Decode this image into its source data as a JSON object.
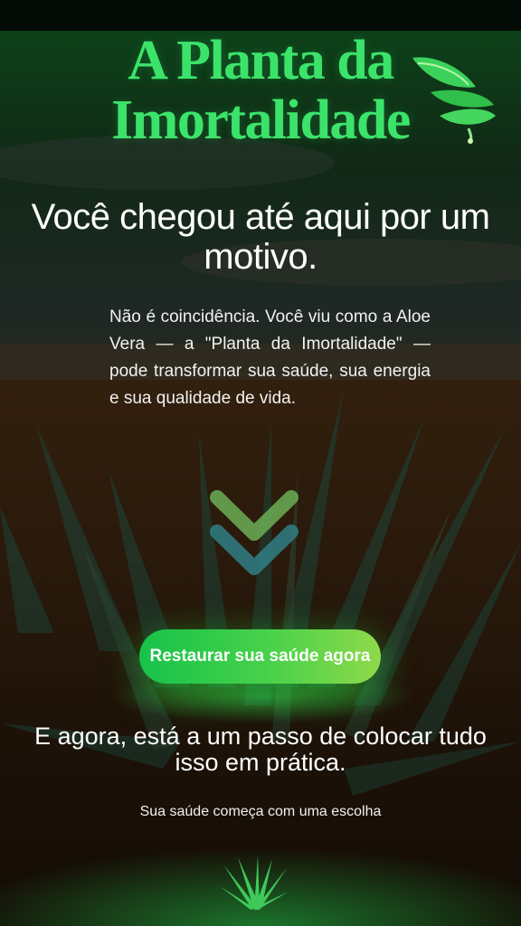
{
  "hero": {
    "title_line1": "A Planta da",
    "title_line2": "Imortalidade"
  },
  "headline": "Você chegou até aqui por um motivo.",
  "intro_text": "Não é coincidência. Você viu como a Aloe Vera — a \"Planta da Imortalidade\" — pode transformar sua saúde, sua energia e sua qualidade de vida.",
  "cta": {
    "label": "Restaurar sua saúde agora"
  },
  "subheadline": "E agora, está a um passo de colocar tudo isso em prática.",
  "tagline": "Sua saúde começa com uma escolha",
  "icons": {
    "top_right": "aloe-leaf-icon",
    "scroll": "double-chevron-down-icon",
    "bottom": "aloe-plant-icon"
  },
  "colors": {
    "title_green": "#3ce36b",
    "button_start": "#17c24a",
    "button_end": "#8fd94a",
    "chevron_green": "#6fb85a",
    "chevron_teal": "#2f7f86"
  }
}
